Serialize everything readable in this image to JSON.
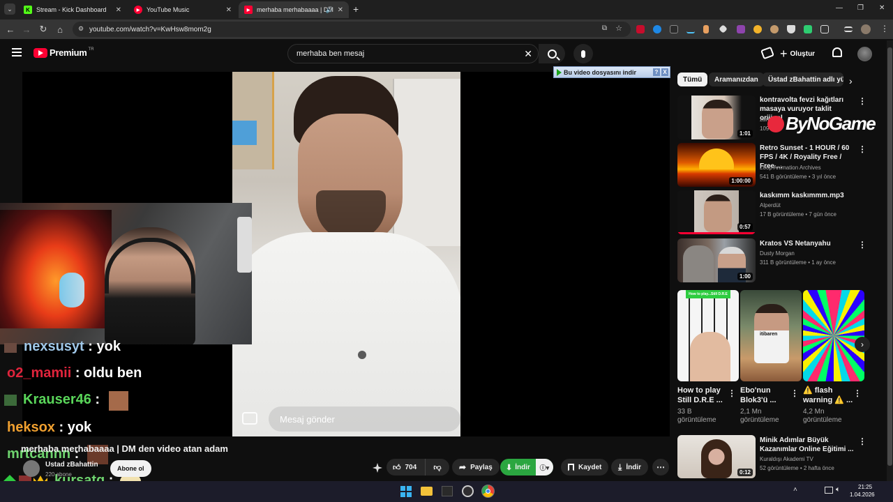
{
  "browser": {
    "tabs": [
      {
        "title": "Stream - Kick Dashboard",
        "favicon": "K"
      },
      {
        "title": "YouTube Music",
        "favicon": "▶"
      },
      {
        "title": "merhaba merhabaaaa | DM",
        "favicon": "▶"
      }
    ],
    "url": "youtube.com/watch?v=KwHsw8mom2g"
  },
  "youtube": {
    "logo_text": "Premium",
    "logo_region": "TR",
    "search_value": "merhaba ben mesaj",
    "create_label": "Oluştur"
  },
  "overlay": {
    "download_banner": "Bu video dosyasını indir",
    "banner_help": "?",
    "banner_close": "X"
  },
  "video": {
    "dm_placeholder": "Mesaj gönder",
    "title": "merhaba merhabaaaa | DM den video atan adam",
    "channel": "Ustad zBahattin",
    "subscribers": "220 abone",
    "subscribe_label": "Abone ol",
    "likes": "704",
    "share_label": "Paylaş",
    "download_label": "İndir",
    "save_label": "Kaydet",
    "download2_label": "İndir"
  },
  "chat": [
    {
      "user": "nexsusyt",
      "sep": " : ",
      "msg": "yok",
      "color": "#9fc7e8"
    },
    {
      "user": "o2_mamii",
      "sep": " : ",
      "msg": "oldu ben",
      "color": "#e0243c"
    },
    {
      "user": "Krauser46",
      "sep": " : ",
      "msg": "",
      "color": "#5ad65a"
    },
    {
      "user": "heksox",
      "sep": " : ",
      "msg": "yok",
      "color": "#f0a030"
    },
    {
      "user": "mrtcannn",
      "sep": " : ",
      "msg": "",
      "color": "#6ed36e"
    },
    {
      "user": "kursatq",
      "sep": " : ",
      "msg": "",
      "color": "#6ed36e"
    }
  ],
  "watermark": "ByNoGame",
  "sidebar": {
    "chips": [
      "Tümü",
      "Aramanızdan",
      "Üstad zBahattin adlı yük"
    ],
    "videos": [
      {
        "title": "kontravolta fevzi kağıtları masaya vuruyor taklit orijinal",
        "channel": "zart",
        "meta": "109",
        "duration": "1:01"
      },
      {
        "title": "Retro Sunset - 1 HOUR / 60 FPS / 4K / Royality Free / Free ...",
        "channel": "Loop Animation Archives",
        "meta": "541 B görüntüleme • 3 yıl önce",
        "duration": "1:00:00"
      },
      {
        "title": "kaskımm kaskımmm.mp3",
        "channel": "Alperdüt",
        "meta": "17 B görüntüleme • 7 gün önce",
        "duration": "0:57"
      },
      {
        "title": "Kratos VS Netanyahu",
        "channel": "Dusty Morgan",
        "meta": "311 B görüntüleme • 1 ay önce",
        "duration": "1:00"
      }
    ],
    "shorts": [
      {
        "title": "How to play Still D.R.E ...",
        "views": "33 B görüntüleme",
        "caption": "How to play...Still D.R.E"
      },
      {
        "title": "Ebo'nun Blok3'ü ...",
        "views": "2,1 Mn görüntüleme",
        "caption": "itibaren"
      },
      {
        "title": "⚠️ flash warning ⚠️ ...",
        "views": "4,2 Mn görüntüleme",
        "caption": ""
      }
    ],
    "last_video": {
      "title": "Minik Adımlar Büyük Kazanımlar Online Eğitimi ...",
      "channel": "Kuraldışı Akademi TV",
      "meta": "52 görüntüleme • 2 hafta önce",
      "duration": "0:12"
    }
  },
  "taskbar": {
    "time": "21:25",
    "date": "1.04.2026"
  },
  "colors": {
    "yt_red": "#ff0033",
    "download_green": "#2ba640",
    "chrome_dark": "#1f1f1f"
  }
}
